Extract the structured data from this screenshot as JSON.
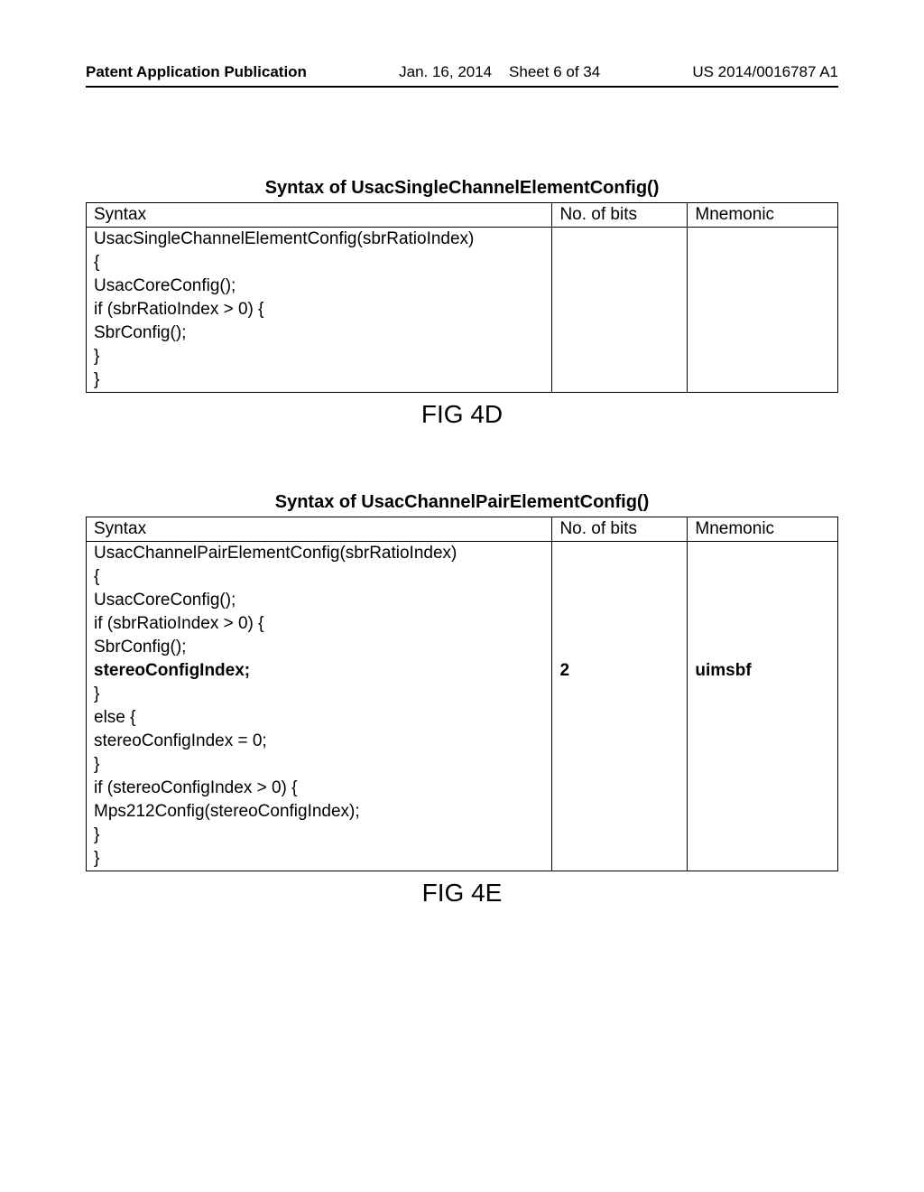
{
  "header": {
    "left": "Patent Application Publication",
    "date": "Jan. 16, 2014",
    "sheet": "Sheet 6 of 34",
    "right": "US 2014/0016787 A1"
  },
  "table1": {
    "title": "Syntax of UsacSingleChannelElementConfig()",
    "head": {
      "syntax": "Syntax",
      "bits": "No. of bits",
      "mnem": "Mnemonic"
    },
    "rows": [
      {
        "text": "UsacSingleChannelElementConfig(sbrRatioIndex)",
        "bits": "",
        "mnem": "",
        "indent": 0,
        "bold": false
      },
      {
        "text": "{",
        "bits": "",
        "mnem": "",
        "indent": 0,
        "bold": false
      },
      {
        "text": "UsacCoreConfig();",
        "bits": "",
        "mnem": "",
        "indent": 1,
        "bold": false
      },
      {
        "text": "if (sbrRatioIndex > 0) {",
        "bits": "",
        "mnem": "",
        "indent": 1,
        "bold": false
      },
      {
        "text": "SbrConfig();",
        "bits": "",
        "mnem": "",
        "indent": 2,
        "bold": false
      },
      {
        "text": "}",
        "bits": "",
        "mnem": "",
        "indent": 1,
        "bold": false
      },
      {
        "text": "}",
        "bits": "",
        "mnem": "",
        "indent": 0,
        "bold": false
      }
    ],
    "caption": "FIG 4D"
  },
  "table2": {
    "title": "Syntax of UsacChannelPairElementConfig()",
    "head": {
      "syntax": "Syntax",
      "bits": "No. of bits",
      "mnem": "Mnemonic"
    },
    "rows": [
      {
        "text": "UsacChannelPairElementConfig(sbrRatioIndex)",
        "bits": "",
        "mnem": "",
        "indent": 0,
        "bold": false
      },
      {
        "text": "{",
        "bits": "",
        "mnem": "",
        "indent": 0,
        "bold": false
      },
      {
        "text": "UsacCoreConfig();",
        "bits": "",
        "mnem": "",
        "indent": 1,
        "bold": false
      },
      {
        "text": "if (sbrRatioIndex > 0) {",
        "bits": "",
        "mnem": "",
        "indent": 1,
        "bold": false
      },
      {
        "text": "SbrConfig();",
        "bits": "",
        "mnem": "",
        "indent": 2,
        "bold": false
      },
      {
        "text": "stereoConfigIndex;",
        "bits": "2",
        "mnem": "uimsbf",
        "indent": 2,
        "bold": true
      },
      {
        "text": "}",
        "bits": "",
        "mnem": "",
        "indent": 1,
        "bold": false
      },
      {
        "text": "else {",
        "bits": "",
        "mnem": "",
        "indent": 1,
        "bold": false
      },
      {
        "text": "stereoConfigIndex = 0;",
        "bits": "",
        "mnem": "",
        "indent": 2,
        "bold": false
      },
      {
        "text": "}",
        "bits": "",
        "mnem": "",
        "indent": 1,
        "bold": false
      },
      {
        "text": "if (stereoConfigIndex > 0) {",
        "bits": "",
        "mnem": "",
        "indent": 1,
        "bold": false
      },
      {
        "text": "Mps212Config(stereoConfigIndex);",
        "bits": "",
        "mnem": "",
        "indent": 2,
        "bold": false
      },
      {
        "text": "}",
        "bits": "",
        "mnem": "",
        "indent": 1,
        "bold": false
      },
      {
        "text": "}",
        "bits": "",
        "mnem": "",
        "indent": 0,
        "bold": false
      }
    ],
    "caption": "FIG 4E"
  }
}
